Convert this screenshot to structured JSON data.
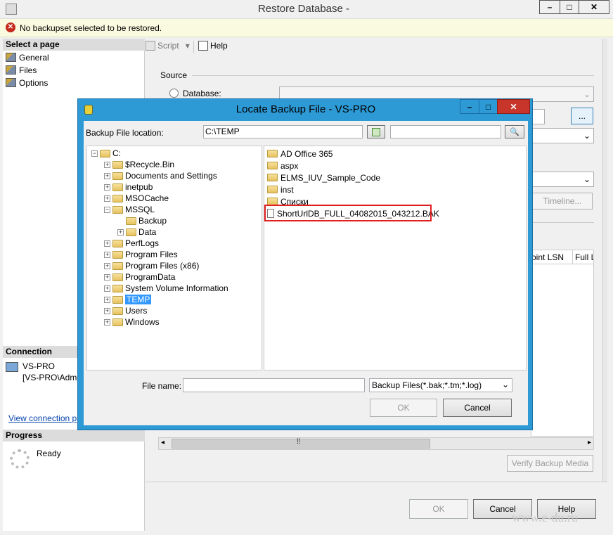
{
  "window": {
    "title": "Restore Database -",
    "minimize": "–",
    "maximize": "□",
    "close": "✕"
  },
  "error_bar": {
    "icon": "error-icon",
    "message": "No backupset selected to be restored."
  },
  "left_panel": {
    "select_page_header": "Select a page",
    "pages": [
      "General",
      "Files",
      "Options"
    ],
    "connection_header": "Connection",
    "server": "VS-PRO",
    "user": "[VS-PRO\\Admi",
    "view_connection": "View connection p",
    "progress_header": "Progress",
    "progress_status": "Ready"
  },
  "toolbar": {
    "script_label": "Script",
    "script_arrow": "▾",
    "help_label": "Help"
  },
  "source": {
    "label": "Source",
    "database_label": "Database:",
    "browse_button": "...",
    "timeline_button": "Timeline...",
    "col_point_lsn": "oint LSN",
    "col_full_ls": "Full LS",
    "verify_button": "Verify Backup Media"
  },
  "footer": {
    "ok": "OK",
    "cancel": "Cancel",
    "help": "Help"
  },
  "watermark": "www.e-du.ru",
  "dialog": {
    "title": "Locate Backup File - VS-PRO",
    "minimize": "–",
    "maximize": "□",
    "close": "✕",
    "location_label": "Backup File location:",
    "location_value": "C:\\TEMP",
    "refresh_icon": "refresh-icon",
    "search_placeholder": "",
    "search_icon": "search-icon",
    "tree": {
      "root": "C:",
      "items": [
        "$Recycle.Bin",
        "Documents and Settings",
        "inetpub",
        "MSOCache",
        "MSSQL",
        "Backup",
        "Data",
        "PerfLogs",
        "Program Files",
        "Program Files (x86)",
        "ProgramData",
        "System Volume Information",
        "TEMP",
        "Users",
        "Windows"
      ]
    },
    "files": [
      "AD Office 365",
      "aspx",
      "ELMS_IUV_Sample_Code",
      "inst",
      "Списки"
    ],
    "backup_file": "ShortUrlDB_FULL_04082015_043212.BAK",
    "file_name_label": "File name:",
    "file_name_value": "",
    "filter_value": "Backup Files(*.bak;*.tm;*.log)",
    "ok": "OK",
    "cancel": "Cancel"
  }
}
